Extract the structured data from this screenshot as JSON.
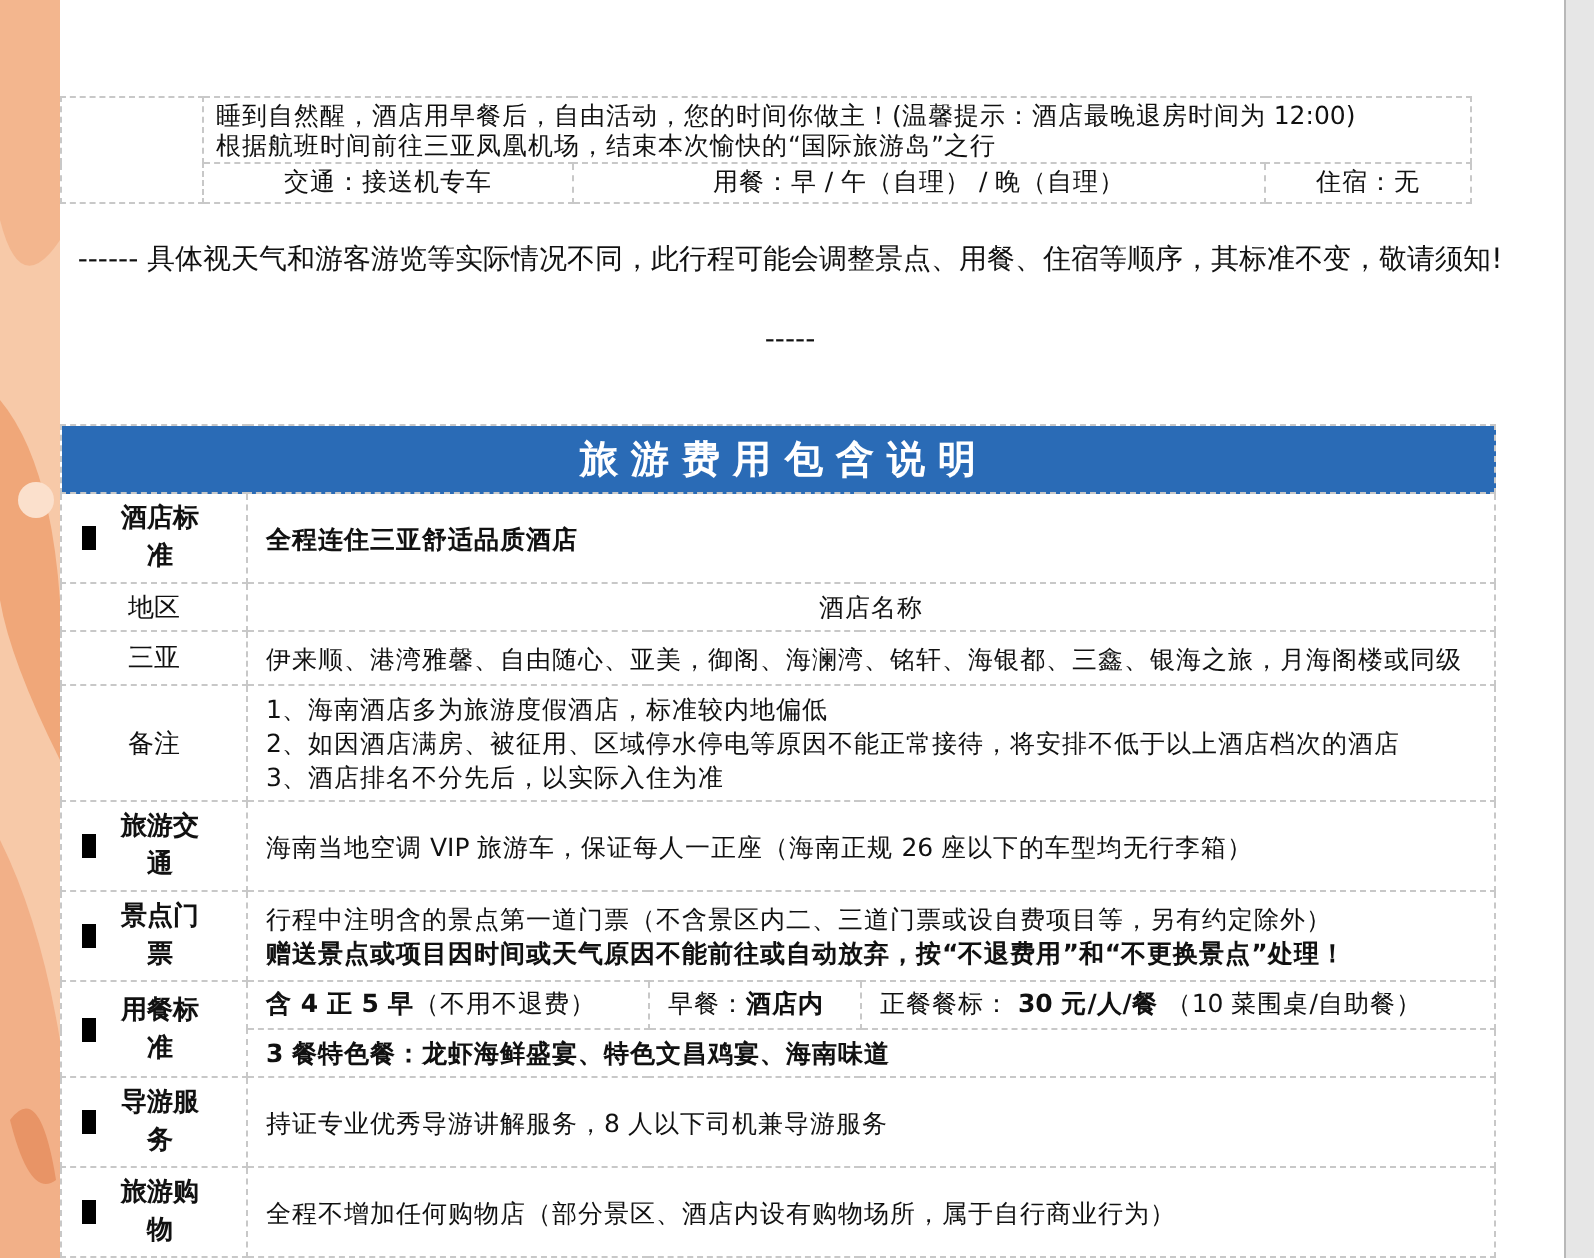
{
  "itinerary": {
    "lines": [
      "睡到自然醒，酒店用早餐后，自由活动，您的时间你做主！(温馨提示：酒店最晚退房时间为 12:00)",
      "根据航班时间前往三亚凤凰机场，结束本次愉快的“国际旅游岛”之行"
    ],
    "cells": [
      "交通：接送机专车",
      "用餐：早 / 午（自理） / 晚（自理）",
      "住宿：无"
    ]
  },
  "notice": "------    具体视天气和游客游览等实际情况不同，此行程可能会调整景点、用餐、住宿等顺序，其标准不变，敬请须知!    -----",
  "fee_table": {
    "title": "旅 游 费 用 包 含 说 明",
    "rows": [
      {
        "kind": "section",
        "label": "酒店标准",
        "lines": [
          {
            "text": "全程连住三亚舒适品质酒店",
            "bold": true
          }
        ]
      },
      {
        "kind": "header",
        "label": "地区",
        "lines": [
          {
            "text": "酒店名称",
            "bold": false
          }
        ]
      },
      {
        "kind": "sub",
        "label": "三亚",
        "lines": [
          {
            "text": "伊来顺、港湾雅馨、自由随心、亚美，御阁、海澜湾、铭轩、海银都、三鑫、银海之旅，月海阁楼或同级",
            "bold": false
          }
        ]
      },
      {
        "kind": "sub",
        "label": "备注",
        "lines": [
          {
            "text": "1、海南酒店多为旅游度假酒店，标准较内地偏低",
            "bold": false
          },
          {
            "text": "2、如因酒店满房、被征用、区域停水停电等原因不能正常接待，将安排不低于以上酒店档次的酒店",
            "bold": false
          },
          {
            "text": "3、酒店排名不分先后，以实际入住为准",
            "bold": false
          }
        ]
      },
      {
        "kind": "section",
        "label": "旅游交通",
        "lines": [
          {
            "text": "海南当地空调 VIP 旅游车，保证每人一正座（海南正规 26 座以下的车型均无行李箱）",
            "bold": false
          }
        ]
      },
      {
        "kind": "section",
        "label": "景点门票",
        "lines": [
          {
            "text": "行程中注明含的景点第一道门票（不含景区内二、三道门票或设自费项目等，另有约定除外）",
            "bold": false
          },
          {
            "text": "赠送景点或项目因时间或天气原因不能前往或自动放弃，按“不退费用”和“不更换景点”处理！",
            "bold": true
          }
        ]
      },
      {
        "kind": "meals",
        "label": "用餐标准",
        "cells": [
          "**含 4 正 5 早**（不用不退费）",
          "早餐：**酒店内**",
          "正餐餐标：  **30 元/人/餐**  （10 菜围桌/自助餐）"
        ],
        "lines": [
          {
            "text": "3 餐特色餐：龙虾海鲜盛宴、特色文昌鸡宴、海南味道",
            "bold": true
          }
        ]
      },
      {
        "kind": "section",
        "label": "导游服务",
        "lines": [
          {
            "text": "持证专业优秀导游讲解服务，8 人以下司机兼导游服务",
            "bold": false
          }
        ]
      },
      {
        "kind": "section",
        "label": "旅游购物",
        "lines": [
          {
            "text": "全程不增加任何购物店（部分景区、酒店内设有购物场所，属于自行商业行为）",
            "bold": false
          }
        ]
      }
    ]
  }
}
